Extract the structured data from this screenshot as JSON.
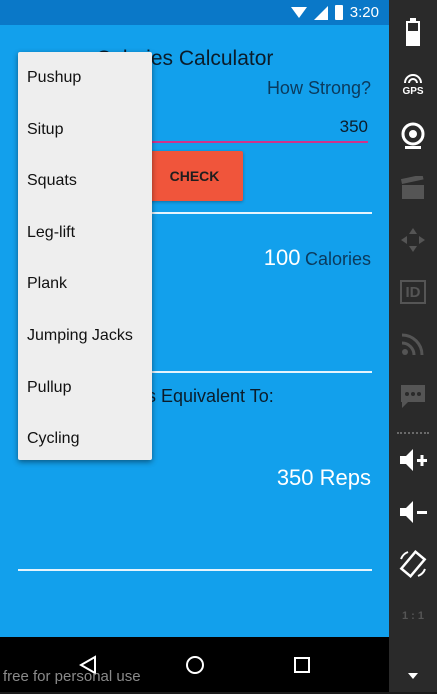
{
  "status_bar": {
    "time": "3:20"
  },
  "app": {
    "title": "Calories Calculator",
    "strength_label": "How Strong?",
    "reps_value": "350",
    "check_button": "CHECK",
    "calories_value": "100",
    "calories_unit": "Calories",
    "equivalent_label": "Is Equivalent To:",
    "result_text": "350 Reps"
  },
  "dropdown": {
    "items": [
      "Pushup",
      "Situp",
      "Squats",
      "Leg-lift",
      "Plank",
      "Jumping Jacks",
      "Pullup",
      "Cycling"
    ]
  },
  "emulator": {
    "gps_label": "GPS",
    "id_label": "ID",
    "ratio_label": "1 : 1"
  },
  "watermark": "free for personal use",
  "colors": {
    "app_background": "#12a0ec",
    "accent_button": "#f0553b",
    "input_underline": "#d0338c",
    "dropdown_background": "#eeeeee"
  }
}
